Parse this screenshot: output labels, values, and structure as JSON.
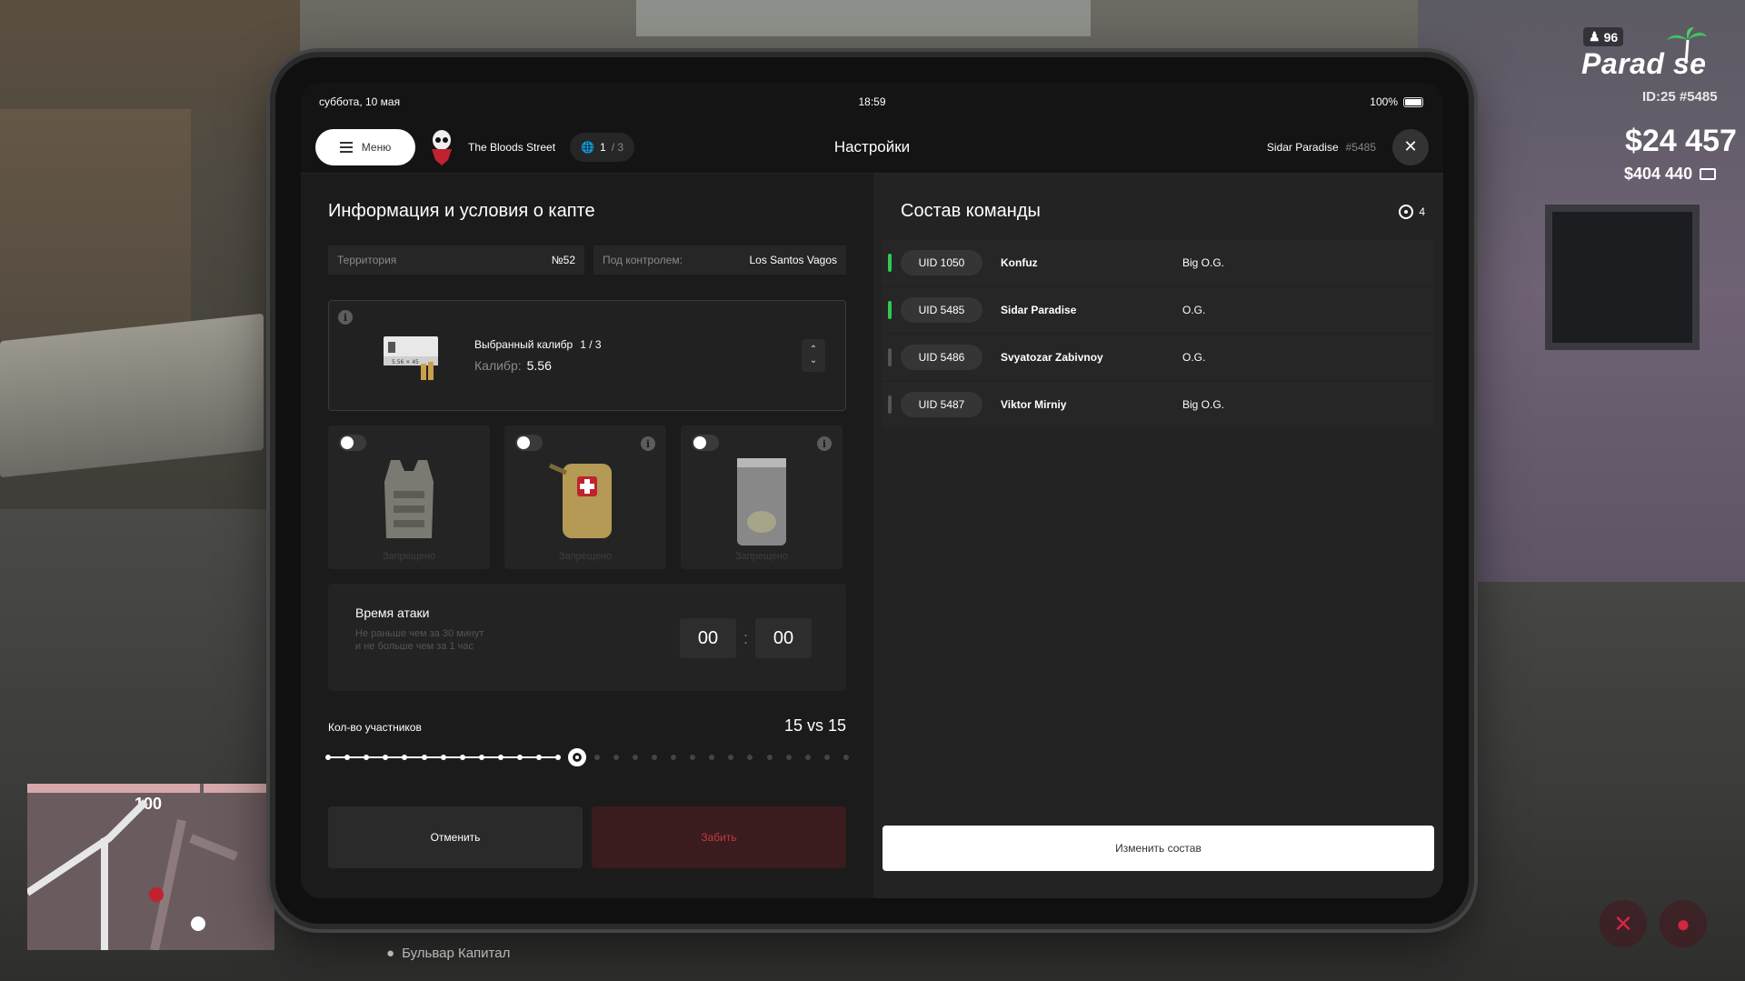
{
  "hud": {
    "online": "96",
    "logo": "Parad se",
    "id": "ID:25 #5485",
    "money": "$24 457",
    "bank": "$404 440",
    "minimap_label": "100",
    "location": "Бульвар Капитал"
  },
  "statusbar": {
    "date": "суббота, 10 мая",
    "time": "18:59",
    "battery": "100%"
  },
  "topbar": {
    "menu_label": "Меню",
    "gang_name": "The Bloods Street",
    "globe_current": "1",
    "globe_total": "/ 3",
    "title": "Настройки",
    "user_name": "Sidar Paradise",
    "user_uid": "#5485"
  },
  "capture": {
    "title": "Информация и условия о капте",
    "territory_label": "Территория",
    "territory_value": "№52",
    "control_label": "Под контролем:",
    "control_value": "Los Santos Vagos",
    "caliber_label": "Выбранный калибр",
    "caliber_count": "1 / 3",
    "caliber_key": "Калибр:",
    "caliber_value": "5.56",
    "ammo_text": "5.56 × 45",
    "items": [
      {
        "name": "armor-vest",
        "status": "Запрещено",
        "enabled": false
      },
      {
        "name": "medkit",
        "status": "Запрещено",
        "enabled": false
      },
      {
        "name": "herb-bag",
        "status": "Запрещено",
        "enabled": false
      }
    ],
    "attack_title": "Время атаки",
    "attack_desc": "Не раньше чем за 30 минут и не больше чем за 1 час",
    "attack_hours": "00",
    "attack_minutes": "00",
    "players_label": "Кол-во участников",
    "players_value": "15 vs 15",
    "players_selected": 13,
    "players_steps": 28,
    "cancel_label": "Отменить",
    "book_label": "Забить"
  },
  "team": {
    "title": "Состав команды",
    "count": "4",
    "members": [
      {
        "uid": "UID 1050",
        "name": "Konfuz",
        "rank": "Big O.G.",
        "online": true
      },
      {
        "uid": "UID 5485",
        "name": "Sidar Paradise",
        "rank": "O.G.",
        "online": true
      },
      {
        "uid": "UID 5486",
        "name": "Svyatozar Zabivnoy",
        "rank": "O.G.",
        "online": false
      },
      {
        "uid": "UID 5487",
        "name": "Viktor Mirniy",
        "rank": "Big O.G.",
        "online": false
      }
    ],
    "change_label": "Изменить состав"
  },
  "colors": {
    "online": "#2fca52",
    "offline": "#555555",
    "danger": "#c23a44"
  }
}
